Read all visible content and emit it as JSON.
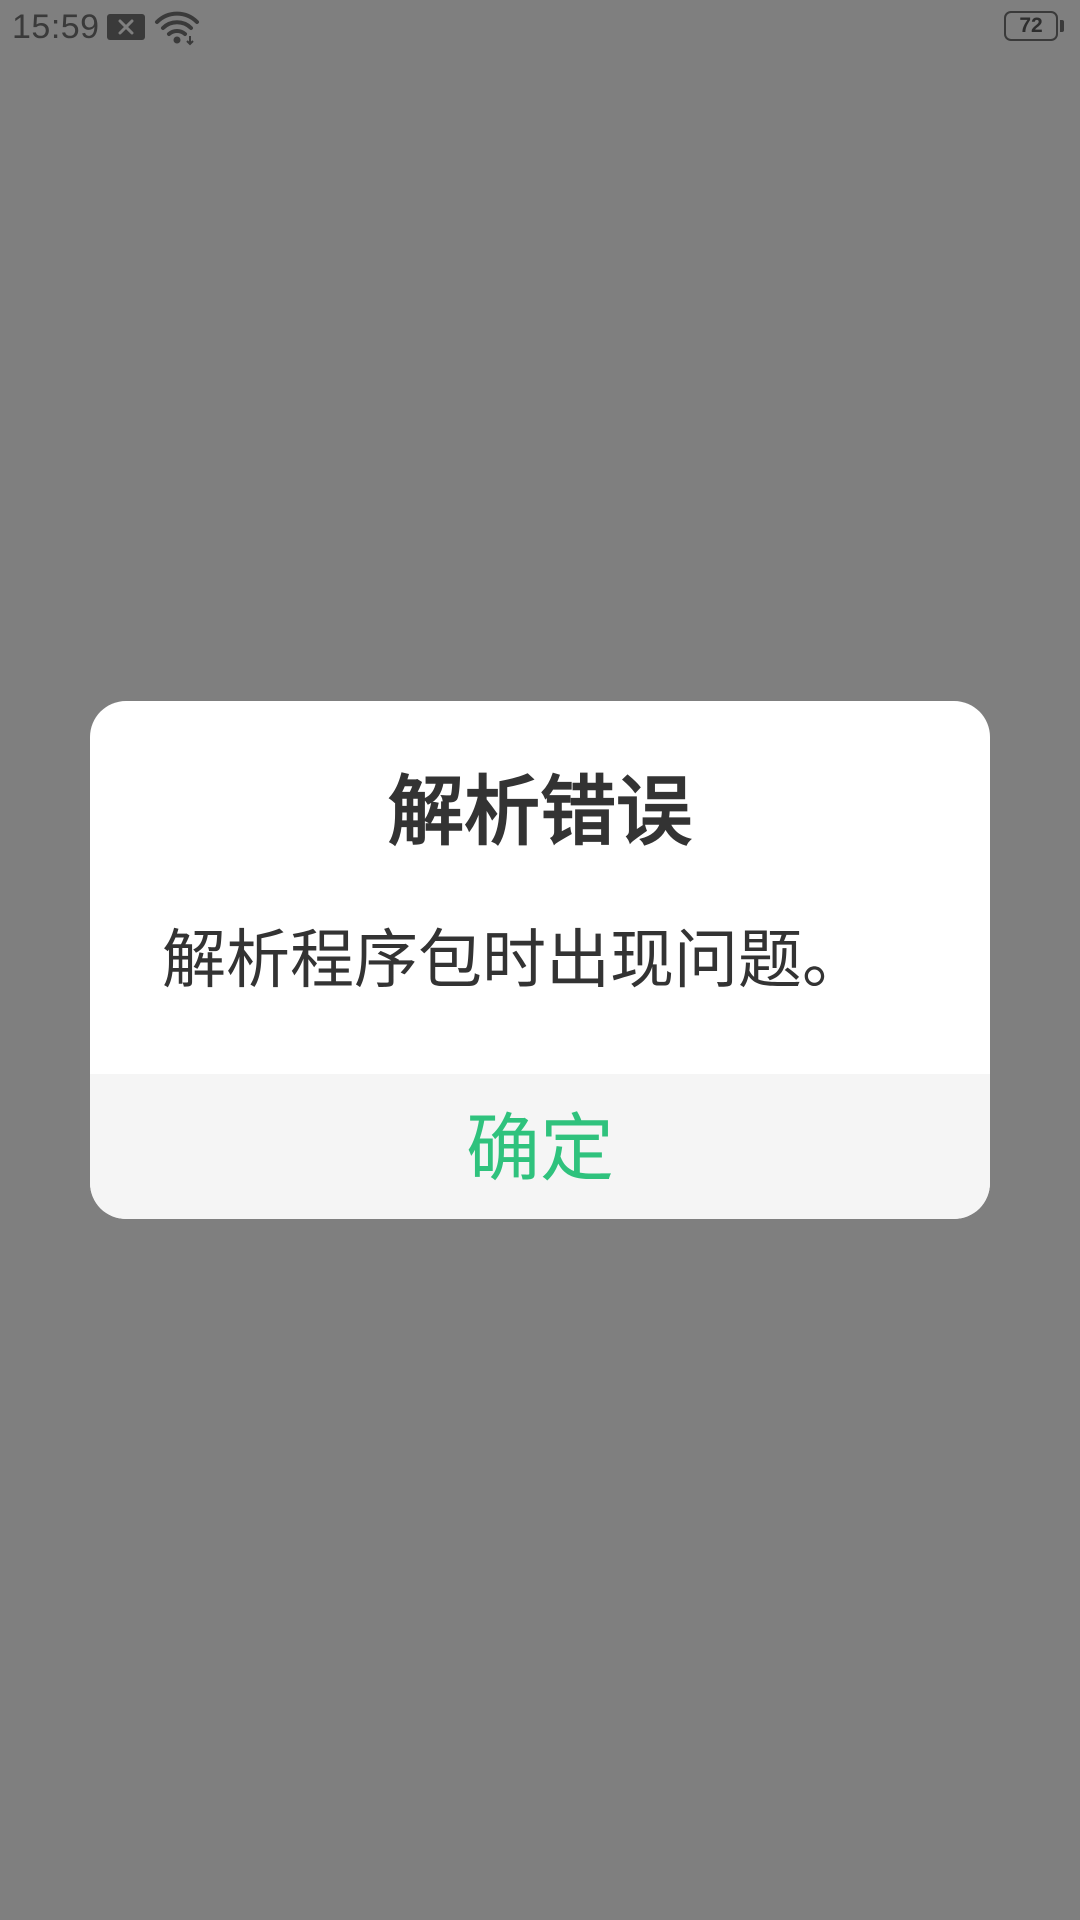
{
  "status_bar": {
    "time": "15:59",
    "battery_level": "72",
    "icons": [
      "notification-x-icon",
      "wifi-icon",
      "battery-icon"
    ]
  },
  "dialog": {
    "title": "解析错误",
    "message": "解析程序包时出现问题。",
    "confirm_label": "确定"
  },
  "colors": {
    "overlay": "#7f7f7f",
    "dialog_bg": "#ffffff",
    "footer_bg": "#f5f5f5",
    "text": "#333333",
    "accent": "#2fc27d"
  }
}
